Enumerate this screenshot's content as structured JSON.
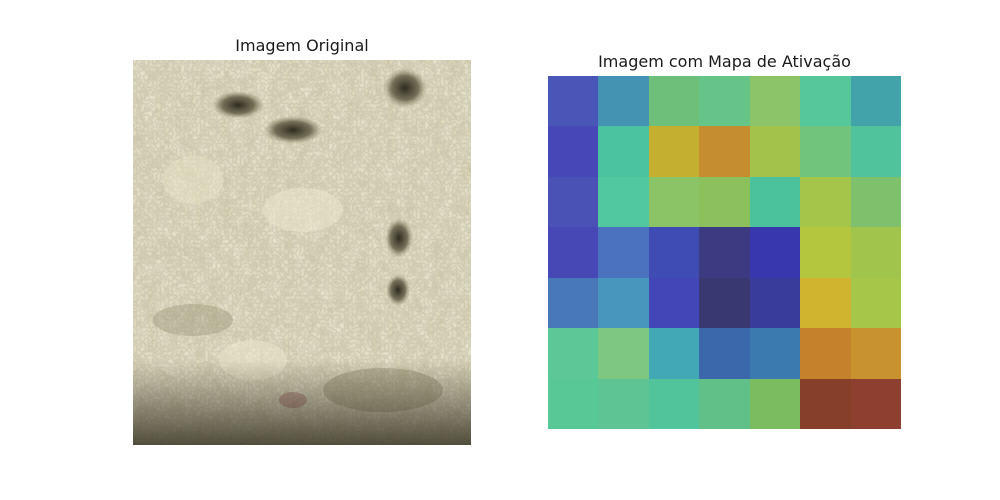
{
  "figure": {
    "left_title": "Imagem Original",
    "right_title": "Imagem com Mapa de Ativação"
  },
  "photo": {
    "subject": "close-up of raw sheep wool fleece",
    "palette": {
      "base": "#d8d2b0",
      "light": "#ece6cc",
      "shadow": "#8e8a6a",
      "dark": "#3e3a2a",
      "stain": "#8a3a4a"
    }
  },
  "activation_map": {
    "rows": 7,
    "cols": 7,
    "colors": [
      [
        "#4a55b8",
        "#4593b2",
        "#6ebf7a",
        "#66c488",
        "#8cc46a",
        "#55c79a",
        "#42a3aa"
      ],
      [
        "#4747b8",
        "#4cc3a0",
        "#c4b02e",
        "#c68d30",
        "#a2c24c",
        "#70c47c",
        "#50c39c"
      ],
      [
        "#4a52b6",
        "#52c8a0",
        "#8bc466",
        "#8cc05c",
        "#4cc29c",
        "#a4c44a",
        "#7ec06c"
      ],
      [
        "#4747b6",
        "#4a72be",
        "#3f4cb4",
        "#3c3a80",
        "#3838ac",
        "#b4c63e",
        "#a0c44c"
      ],
      [
        "#4978b8",
        "#4896be",
        "#4246b6",
        "#3a3870",
        "#3a3c9c",
        "#d0b430",
        "#a6c64a"
      ],
      [
        "#5cc898",
        "#7cc882",
        "#42a8b6",
        "#3a68aa",
        "#3a7aae",
        "#c4822c",
        "#c8922e"
      ],
      [
        "#58c896",
        "#5ec494",
        "#52c49c",
        "#60c088",
        "#7cbc60",
        "#86402a",
        "#8e4030"
      ]
    ]
  }
}
